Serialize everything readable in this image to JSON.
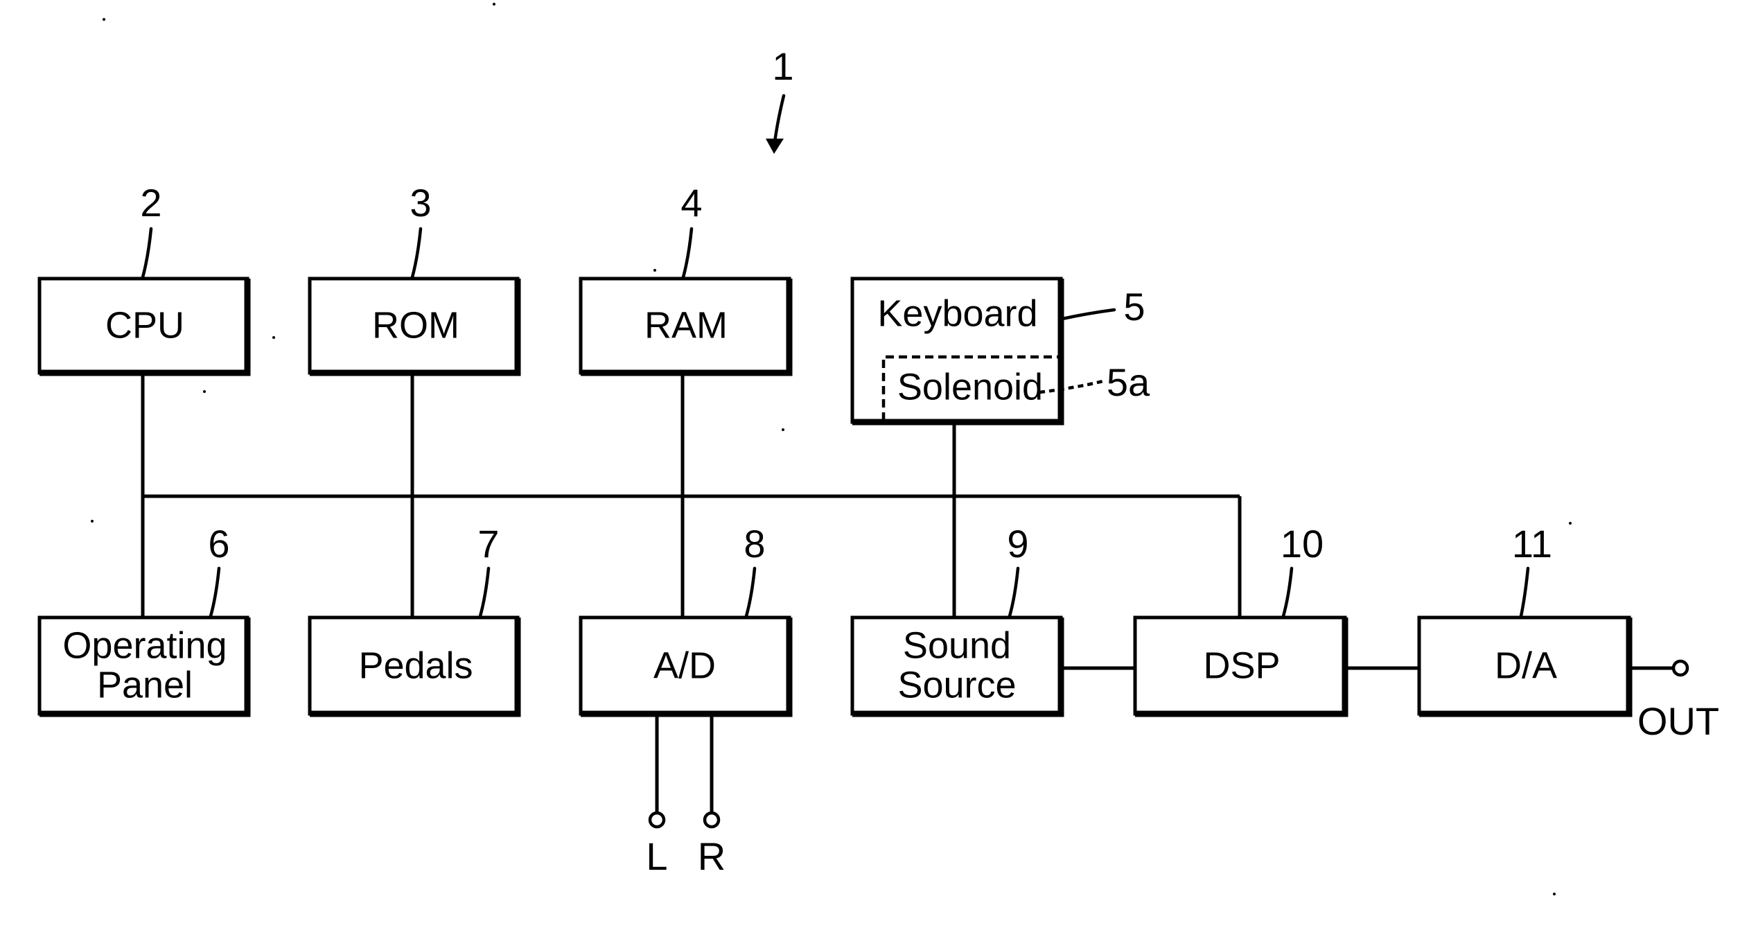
{
  "diagram": {
    "figure_ref": "1",
    "blocks": [
      {
        "id": "cpu",
        "label": "CPU",
        "ref": "2"
      },
      {
        "id": "rom",
        "label": "ROM",
        "ref": "3"
      },
      {
        "id": "ram",
        "label": "RAM",
        "ref": "4"
      },
      {
        "id": "keyboard",
        "label": "Keyboard",
        "ref": "5"
      },
      {
        "id": "solenoid",
        "label": "Solenoid",
        "ref": "5a"
      },
      {
        "id": "operating-panel",
        "label_line1": "Operating",
        "label_line2": "Panel",
        "ref": "6"
      },
      {
        "id": "pedals",
        "label": "Pedals",
        "ref": "7"
      },
      {
        "id": "ad",
        "label": "A/D",
        "ref": "8"
      },
      {
        "id": "sound-source",
        "label_line1": "Sound",
        "label_line2": "Source",
        "ref": "9"
      },
      {
        "id": "dsp",
        "label": "DSP",
        "ref": "10"
      },
      {
        "id": "da",
        "label": "D/A",
        "ref": "11"
      }
    ],
    "terminals": {
      "left_input": "L",
      "right_input": "R",
      "output": "OUT"
    },
    "connections": [
      [
        "cpu",
        "bus"
      ],
      [
        "rom",
        "pedals"
      ],
      [
        "ram",
        "ad"
      ],
      [
        "keyboard",
        "sound-source"
      ],
      [
        "bus",
        "operating-panel"
      ],
      [
        "bus",
        "dsp"
      ],
      [
        "sound-source",
        "dsp"
      ],
      [
        "dsp",
        "da"
      ],
      [
        "da",
        "OUT"
      ],
      [
        "L",
        "ad"
      ],
      [
        "R",
        "ad"
      ]
    ]
  }
}
